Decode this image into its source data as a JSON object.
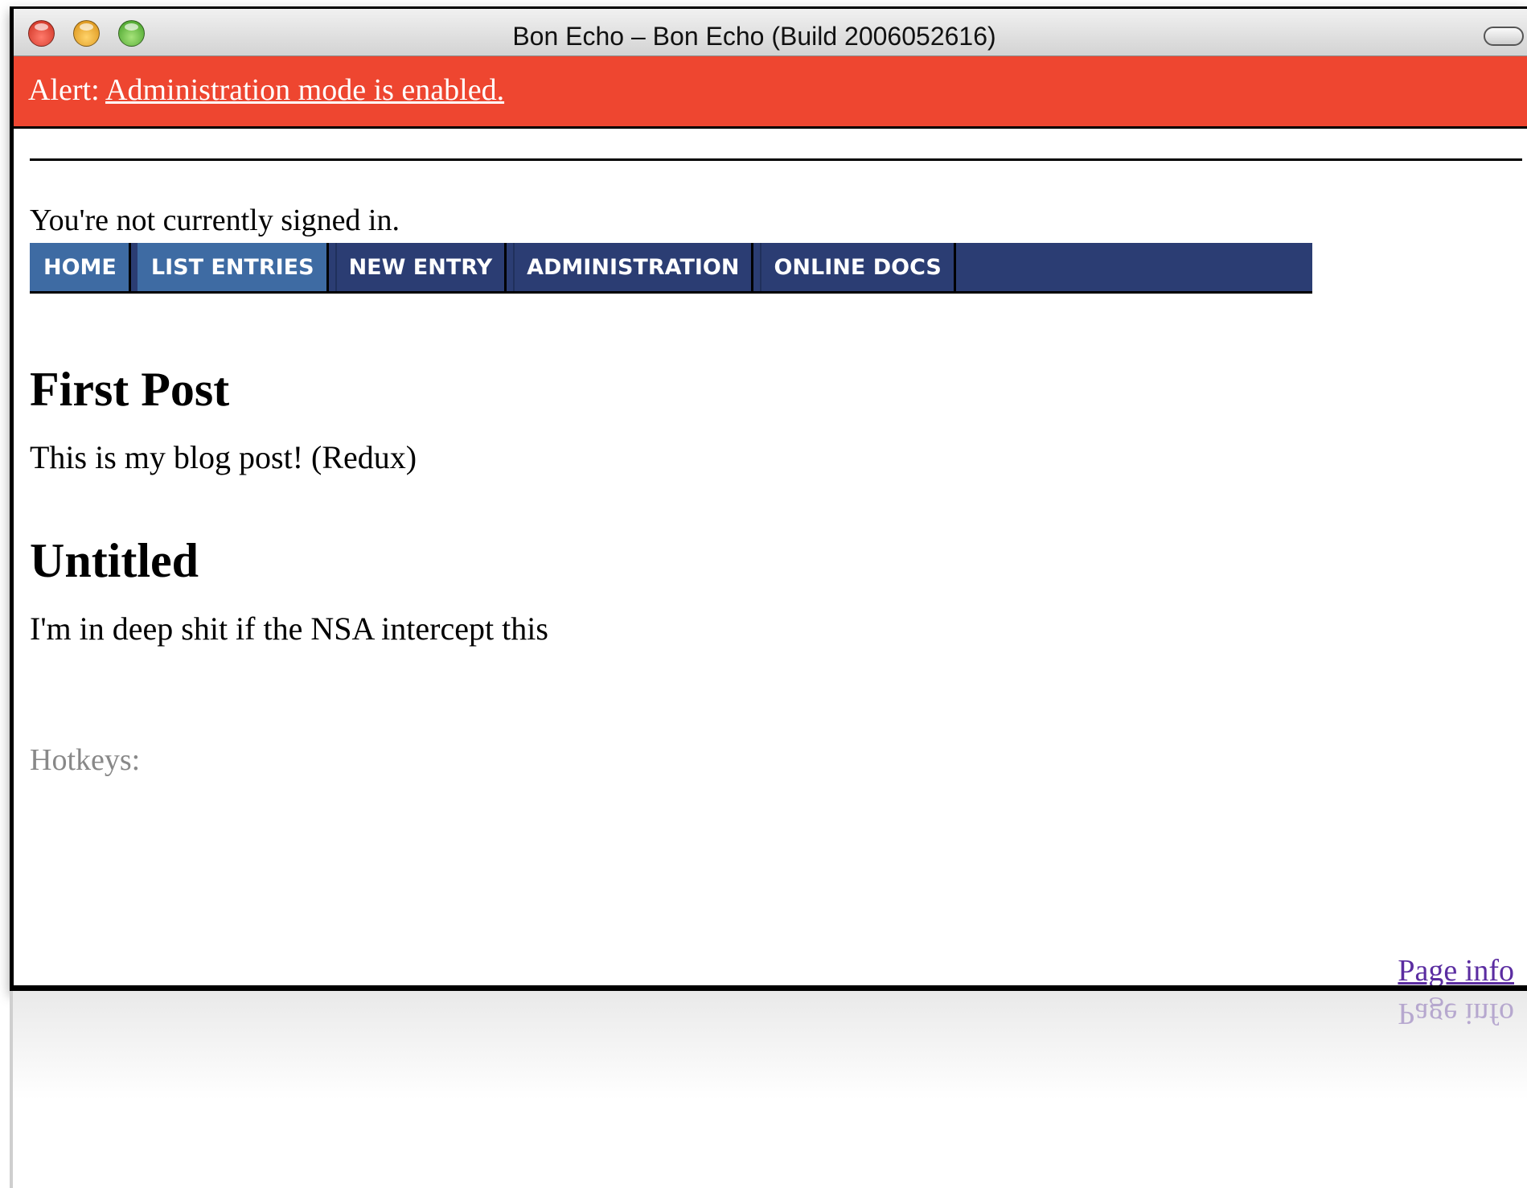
{
  "window": {
    "title": "Bon Echo – Bon Echo (Build 2006052616)"
  },
  "alert": {
    "prefix": "Alert:",
    "link": "Administration mode is enabled."
  },
  "signin_status": "You're not currently signed in.",
  "nav": {
    "tabs": [
      {
        "label": "HOME"
      },
      {
        "label": "LIST ENTRIES"
      },
      {
        "label": "NEW ENTRY"
      },
      {
        "label": "ADMINISTRATION"
      },
      {
        "label": "ONLINE DOCS"
      }
    ]
  },
  "posts": [
    {
      "title": "First Post",
      "body": "This is my blog post! (Redux)"
    },
    {
      "title": "Untitled",
      "body": "I'm in deep shit if the NSA intercept this"
    }
  ],
  "hotkeys_label": "Hotkeys:",
  "footer": {
    "page_info": "Page info"
  },
  "colors": {
    "alert_bg": "#ee4630",
    "nav_bg": "#2b3d73",
    "nav_tab_highlight": "#3e6ba3",
    "link_visited": "#5b2da1"
  }
}
